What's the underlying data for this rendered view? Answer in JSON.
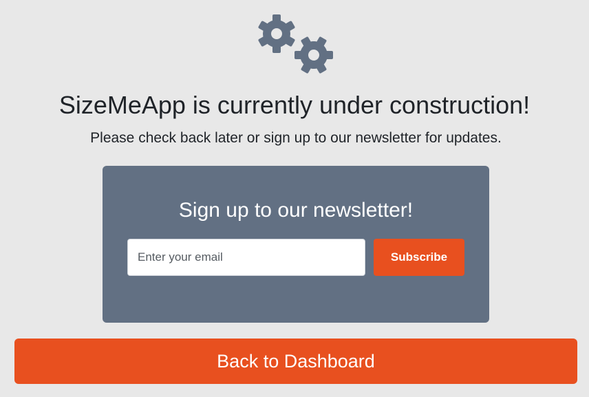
{
  "header": {
    "icon": "gears-icon",
    "title": "SizeMeApp is currently under construction!",
    "subtitle": "Please check back later or sign up to our newsletter for updates."
  },
  "newsletter": {
    "title": "Sign up to our newsletter!",
    "email_placeholder": "Enter your email",
    "email_value": "",
    "subscribe_label": "Subscribe"
  },
  "actions": {
    "back_label": "Back to Dashboard"
  },
  "colors": {
    "background": "#e8e8e8",
    "panel": "#627083",
    "accent": "#e8501f",
    "icon": "#627083",
    "text": "#1f2328"
  }
}
